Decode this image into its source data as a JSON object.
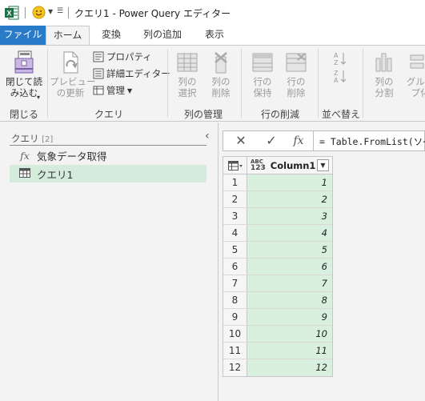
{
  "titlebar": {
    "title": "クエリ1 - Power Query エディター"
  },
  "tabs": {
    "file": "ファイル",
    "home": "ホーム",
    "transform": "変換",
    "add_column": "列の追加",
    "view": "表示"
  },
  "ribbon": {
    "close_load": "閉じて読\nみ込む",
    "close_group": "閉じる",
    "preview_refresh": "プレビュー\nの更新",
    "properties": "プロパティ",
    "advanced_editor": "詳細エディター",
    "manage": "管理",
    "query_group": "クエリ",
    "choose_columns": "列の\n選択",
    "remove_columns": "列の\n削除",
    "manage_columns_group": "列の管理",
    "keep_rows": "行の\n保持",
    "remove_rows": "行の\n削除",
    "reduce_rows_group": "行の削減",
    "sort_group": "並べ替え",
    "split_column": "列の\n分割",
    "group_by": "グルー\nプ化"
  },
  "queries_pane": {
    "header": "クエリ",
    "count": "[2]",
    "items": [
      {
        "label": "気象データ取得",
        "icon": "fx-icon"
      },
      {
        "label": "クエリ1",
        "icon": "table-icon"
      }
    ]
  },
  "formula_bar": {
    "formula": "= Table.FromList(ソ~"
  },
  "grid": {
    "column_type_top": "ABC",
    "column_type_bottom": "123",
    "column_name": "Column1",
    "rows": [
      {
        "n": "1",
        "v": "1"
      },
      {
        "n": "2",
        "v": "2"
      },
      {
        "n": "3",
        "v": "3"
      },
      {
        "n": "4",
        "v": "4"
      },
      {
        "n": "5",
        "v": "5"
      },
      {
        "n": "6",
        "v": "6"
      },
      {
        "n": "7",
        "v": "7"
      },
      {
        "n": "8",
        "v": "8"
      },
      {
        "n": "9",
        "v": "9"
      },
      {
        "n": "10",
        "v": "10"
      },
      {
        "n": "11",
        "v": "11"
      },
      {
        "n": "12",
        "v": "12"
      }
    ]
  },
  "colors": {
    "file_tab": "#2a7bc7",
    "selected_query": "#d5ecdc",
    "column_fill": "#d9f0df",
    "excel_green": "#1e7145"
  }
}
